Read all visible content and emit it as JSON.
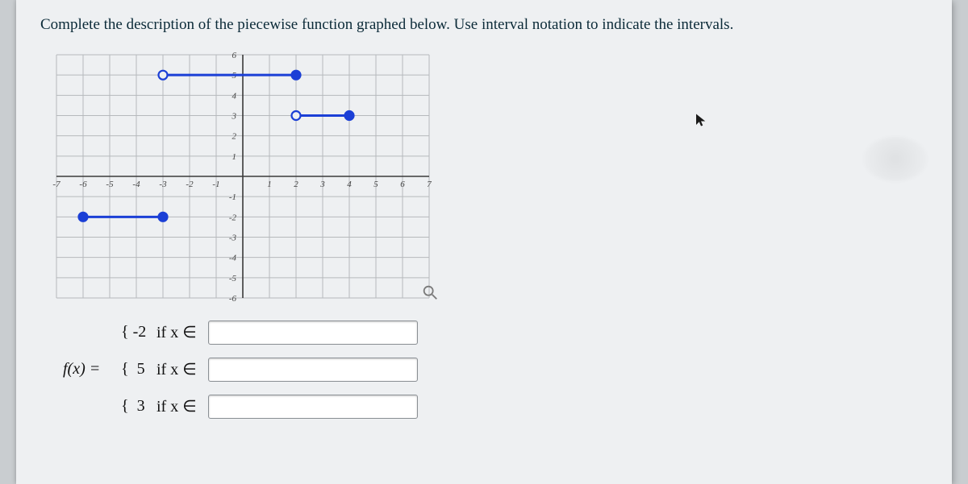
{
  "prompt": "Complete the description of the piecewise function graphed below. Use interval notation to indicate the intervals.",
  "chart_data": {
    "type": "line",
    "xlim": [
      -7,
      7
    ],
    "ylim": [
      -6,
      6
    ],
    "x_ticks": [
      -7,
      -6,
      -5,
      -4,
      -3,
      -2,
      -1,
      1,
      2,
      3,
      4,
      5,
      6,
      7
    ],
    "y_ticks": [
      -6,
      -5,
      -4,
      -3,
      -2,
      -1,
      1,
      2,
      3,
      4,
      5,
      6
    ],
    "grid": true,
    "series": [
      {
        "name": "piece1",
        "y": -2,
        "x_from": -6,
        "x_to": -3,
        "left_closed": true,
        "right_closed": true
      },
      {
        "name": "piece2",
        "y": 5,
        "x_from": -3,
        "x_to": 2,
        "left_closed": false,
        "right_closed": true
      },
      {
        "name": "piece3",
        "y": 3,
        "x_from": 2,
        "x_to": 4,
        "left_closed": false,
        "right_closed": true
      }
    ]
  },
  "answers": {
    "fx_label": "f(x) =",
    "rows": [
      {
        "brace": "{",
        "value": "-2",
        "if_label": "if x ∈",
        "input": ""
      },
      {
        "brace": "{",
        "value": "5",
        "if_label": "if x ∈",
        "input": ""
      },
      {
        "brace": "{",
        "value": "3",
        "if_label": "if x ∈",
        "input": ""
      }
    ]
  },
  "icons": {
    "magnify": "magnify-icon",
    "cursor": "cursor-icon"
  }
}
